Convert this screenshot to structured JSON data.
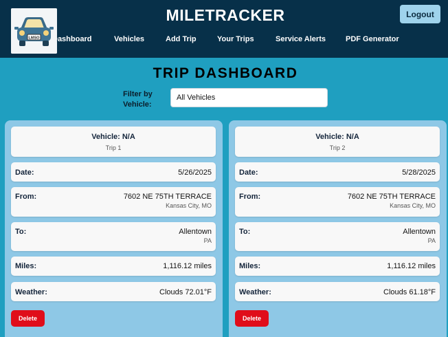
{
  "header": {
    "title": "MILETRACKER",
    "logout_label": "Logout",
    "logo_plate": "LMSO",
    "nav": [
      "Dashboard",
      "Vehicles",
      "Add Trip",
      "Your Trips",
      "Service Alerts",
      "PDF Generator"
    ]
  },
  "page": {
    "title": "TRIP DASHBOARD",
    "filter_label": "Filter by Vehicle:",
    "filter_value": "All Vehicles"
  },
  "trips": [
    {
      "vehicle": "Vehicle: N/A",
      "trip": "Trip 1",
      "date_label": "Date:",
      "date": "5/26/2025",
      "from_label": "From:",
      "from_line1": "7602 NE 75TH TERRACE",
      "from_line2": "Kansas City, MO",
      "to_label": "To:",
      "to_line1": "Allentown",
      "to_line2": "PA",
      "miles_label": "Miles:",
      "miles": "1,116.12 miles",
      "weather_label": "Weather:",
      "weather": "Clouds 72.01°F",
      "delete_label": "Delete"
    },
    {
      "vehicle": "Vehicle: N/A",
      "trip": "Trip 2",
      "date_label": "Date:",
      "date": "5/28/2025",
      "from_label": "From:",
      "from_line1": "7602 NE 75TH TERRACE",
      "from_line2": "Kansas City, MO",
      "to_label": "To:",
      "to_line1": "Allentown",
      "to_line2": "PA",
      "miles_label": "Miles:",
      "miles": "1,116.12 miles",
      "weather_label": "Weather:",
      "weather": "Clouds 61.18°F",
      "delete_label": "Delete"
    }
  ],
  "colors": {
    "header_bg": "#073049",
    "page_bg": "#1f9fc0",
    "card_bg": "#8ec8e6",
    "delete": "#e00d1a",
    "logout": "#9fd3ec"
  }
}
